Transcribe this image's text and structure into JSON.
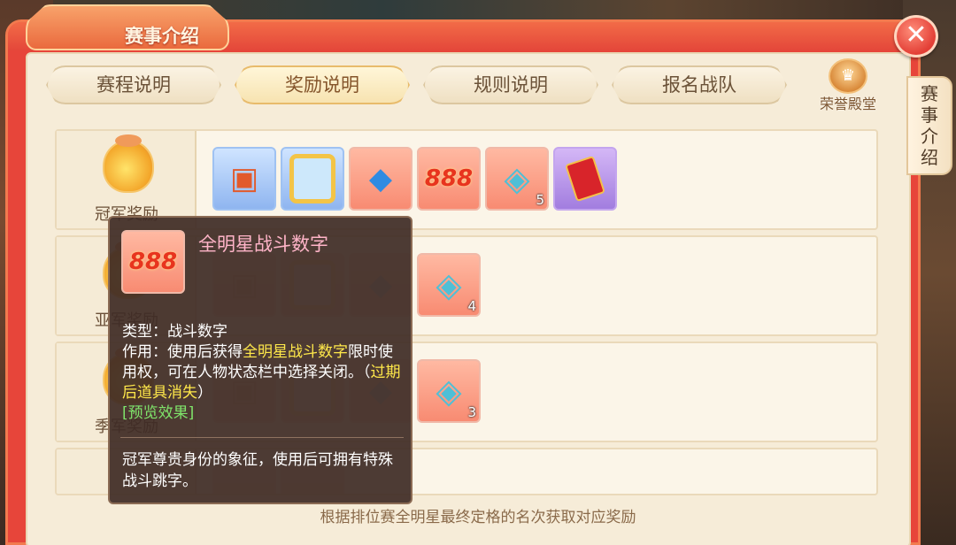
{
  "window": {
    "title": "赛事介绍",
    "close_glyph": "✕"
  },
  "tabs": [
    {
      "label": "赛程说明",
      "active": false
    },
    {
      "label": "奖励说明",
      "active": true
    },
    {
      "label": "规则说明",
      "active": false
    },
    {
      "label": "报名战队",
      "active": false
    }
  ],
  "honor": {
    "label": "荣誉殿堂",
    "icon": "trophy-icon"
  },
  "side_tab": {
    "label": "赛事介绍"
  },
  "rows": [
    {
      "label": "冠军奖励",
      "gem_count": "5"
    },
    {
      "label": "亚军奖励",
      "gem_count": "4"
    },
    {
      "label": "季军奖励",
      "gem_count": "3"
    }
  ],
  "bottom_note": "根据排位赛全明星最终定格的名次获取对应奖励",
  "tooltip": {
    "title": "全明星战斗数字",
    "icon_text": "888",
    "type_label": "类型：",
    "type_value": "战斗数字",
    "usage_label": "作用：",
    "usage_pre": "使用后获得",
    "usage_highlight": "全明星战斗数字",
    "usage_post": "限时使用权，可在人物状态栏中选择关闭。（",
    "expire_note": "过期后道具消失",
    "usage_end": "）",
    "preview_link": "[预览效果]",
    "description": "冠军尊贵身份的象征，使用后可拥有特殊战斗跳字。"
  },
  "colors": {
    "frame_red": "#e7453a",
    "content_bg": "#f6ecd8",
    "tooltip_title": "#ffb4c8",
    "highlight_yellow": "#ffe84a",
    "link_green": "#7fe46a"
  }
}
